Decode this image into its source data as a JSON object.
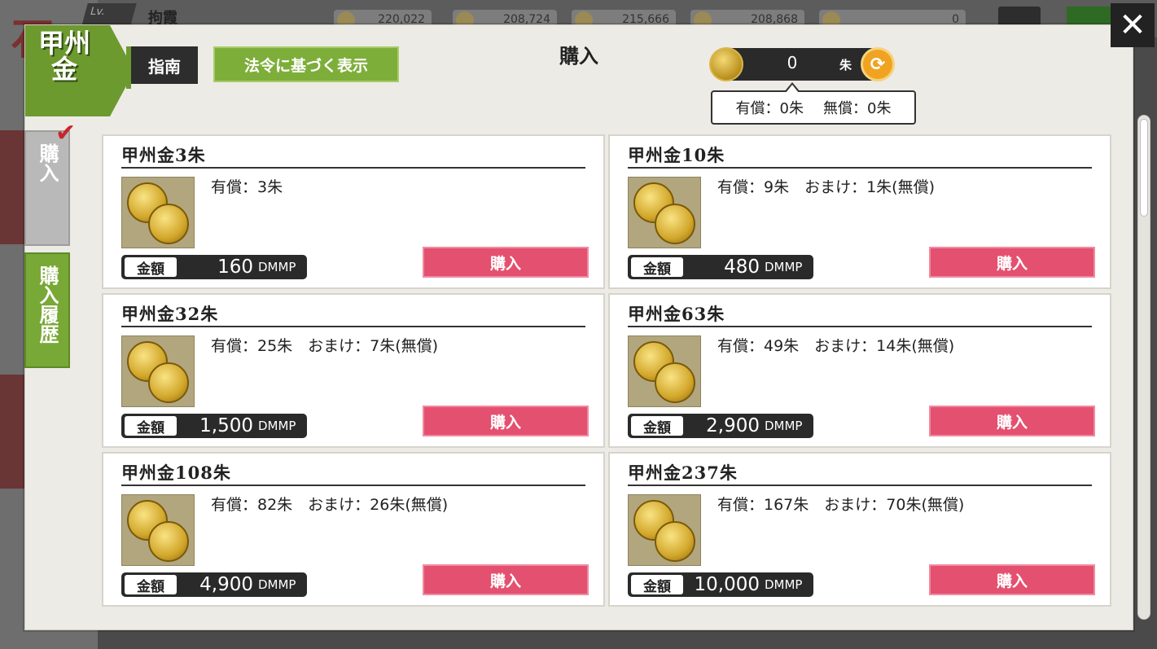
{
  "background": {
    "level_label": "Lv.",
    "player_name": "拘霞",
    "resources": [
      "220,022",
      "208,724",
      "215,666",
      "208,868",
      "0"
    ]
  },
  "dialog": {
    "badge_title": "甲州金",
    "guide_label": "指南",
    "legal_label": "法令に基づく表示",
    "title": "購入",
    "close_label": "✕"
  },
  "currency": {
    "amount": "0",
    "unit": "朱",
    "paid": "有償：0朱",
    "free": "無償：0朱"
  },
  "tabs": {
    "buy": "購入",
    "history": "購入履歴"
  },
  "products": [
    {
      "name": "甲州金3朱",
      "desc": "有償：3朱",
      "price_label": "金額",
      "price": "160",
      "price_unit": "DMMP",
      "button": "購入"
    },
    {
      "name": "甲州金10朱",
      "desc": "有償：9朱　おまけ：1朱(無償)",
      "price_label": "金額",
      "price": "480",
      "price_unit": "DMMP",
      "button": "購入"
    },
    {
      "name": "甲州金32朱",
      "desc": "有償：25朱　おまけ：7朱(無償)",
      "price_label": "金額",
      "price": "1,500",
      "price_unit": "DMMP",
      "button": "購入"
    },
    {
      "name": "甲州金63朱",
      "desc": "有償：49朱　おまけ：14朱(無償)",
      "price_label": "金額",
      "price": "2,900",
      "price_unit": "DMMP",
      "button": "購入"
    },
    {
      "name": "甲州金108朱",
      "desc": "有償：82朱　おまけ：26朱(無償)",
      "price_label": "金額",
      "price": "4,900",
      "price_unit": "DMMP",
      "button": "購入"
    },
    {
      "name": "甲州金237朱",
      "desc": "有償：167朱　おまけ：70朱(無償)",
      "price_label": "金額",
      "price": "10,000",
      "price_unit": "DMMP",
      "button": "購入"
    }
  ]
}
